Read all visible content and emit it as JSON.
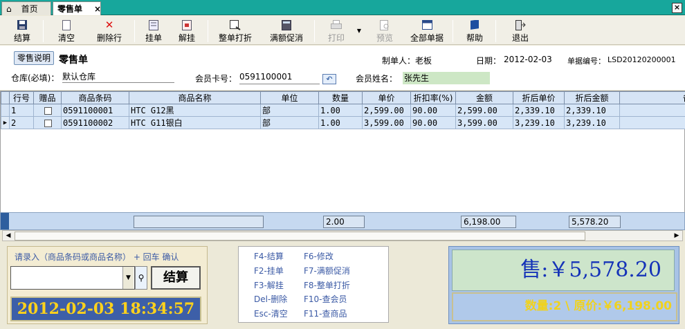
{
  "tabs": {
    "home": "首页",
    "sale": "零售单",
    "close": "×"
  },
  "window": {
    "close": "×"
  },
  "toolbar": {
    "settle": "结算",
    "clear": "清空",
    "delete_row": "删除行",
    "hang": "挂单",
    "unhang": "解挂",
    "print_all": "整单打折",
    "promo": "满额促消",
    "print": "打印",
    "preview": "预览",
    "all_docs": "全部单据",
    "help": "帮助",
    "exit": "退出"
  },
  "header": {
    "desc_btn": "零售说明",
    "title": "零售单",
    "maker_label": "制单人：",
    "maker": "老板",
    "date_label": "日期：",
    "date": "2012-02-03",
    "doc_label": "单据编号：",
    "doc_no": "LSD20120200001",
    "warehouse_label": "仓库(必填)：",
    "warehouse": "默认仓库",
    "card_label": "会员卡号：",
    "card_no": "0591100001",
    "member_label": "会员姓名：",
    "member_name": "张先生"
  },
  "grid": {
    "columns": [
      "行号",
      "赠品",
      "商品条码",
      "商品名称",
      "单位",
      "数量",
      "单价",
      "折扣率(%)",
      "金额",
      "折后单价",
      "折后金额",
      "备注"
    ],
    "rows": [
      {
        "no": "1",
        "gift": false,
        "barcode": "0591100001",
        "name": "HTC G12黑",
        "unit": "部",
        "qty": "1.00",
        "price": "2,599.00",
        "discount": "90.00",
        "amount": "2,599.00",
        "disc_price": "2,339.10",
        "disc_amount": "2,339.10"
      },
      {
        "no": "2",
        "gift": false,
        "barcode": "0591100002",
        "name": "HTC G11银白",
        "unit": "部",
        "qty": "1.00",
        "price": "3,599.00",
        "discount": "90.00",
        "amount": "3,599.00",
        "disc_price": "3,239.10",
        "disc_amount": "3,239.10"
      }
    ],
    "sum": {
      "qty": "2.00",
      "amount": "6,198.00",
      "disc_amount": "5,578.20"
    }
  },
  "entry": {
    "hint": "请录入（商品条码或商品名称） + 回车  确认",
    "settle": "结算",
    "datetime": "2012-02-03  18:34:57"
  },
  "shortcuts": [
    {
      "l": "F4-结算",
      "r": "F6-修改"
    },
    {
      "l": "F2-挂单",
      "r": "F7-满额促消"
    },
    {
      "l": "F3-解挂",
      "r": "F8-整单打折"
    },
    {
      "l": "Del-删除",
      "r": "F10-查会员"
    },
    {
      "l": "Esc-清空",
      "r": "F11-查商品"
    }
  ],
  "totals": {
    "sale": "售:￥5,578.20",
    "qty_line": "数量:2 \\ 原价:￥6,198.00"
  },
  "colors": {
    "tabbar": "#17a79c",
    "total_green": "#cde5cb",
    "clock_bg": "#3d5fa8",
    "clock_fg": "#ffd21b"
  }
}
